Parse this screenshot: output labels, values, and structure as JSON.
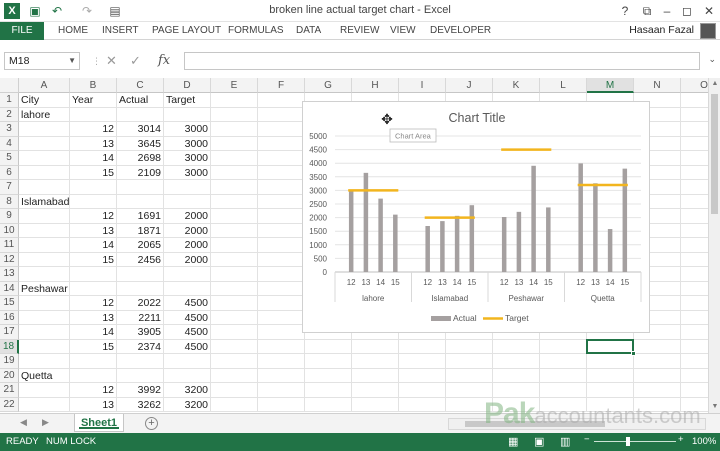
{
  "window": {
    "title": "broken line actual target chart - Excel",
    "controls": [
      "?",
      "⧉",
      "–",
      "◻",
      "✕"
    ]
  },
  "ribbon": {
    "file": "FILE",
    "tabs": [
      "HOME",
      "INSERT",
      "PAGE LAYOUT",
      "FORMULAS",
      "DATA",
      "REVIEW",
      "VIEW",
      "DEVELOPER"
    ],
    "user": "Hasaan Fazal"
  },
  "formula_bar": {
    "name_box": "M18",
    "fx": "fx",
    "value": ""
  },
  "columns": [
    "A",
    "B",
    "C",
    "D",
    "E",
    "F",
    "G",
    "H",
    "I",
    "J",
    "K",
    "L",
    "M",
    "N",
    "O"
  ],
  "selected_column": "M",
  "rows": [
    "1",
    "2",
    "3",
    "4",
    "5",
    "6",
    "7",
    "8",
    "9",
    "10",
    "11",
    "12",
    "13",
    "14",
    "15",
    "16",
    "17",
    "18",
    "19",
    "20",
    "21",
    "22"
  ],
  "selected_row": "18",
  "cells": [
    {
      "r": 1,
      "c": "A",
      "v": "City"
    },
    {
      "r": 1,
      "c": "B",
      "v": "Year"
    },
    {
      "r": 1,
      "c": "C",
      "v": "Actual"
    },
    {
      "r": 1,
      "c": "D",
      "v": "Target"
    },
    {
      "r": 2,
      "c": "A",
      "v": "lahore"
    },
    {
      "r": 3,
      "c": "B",
      "v": "12",
      "n": true
    },
    {
      "r": 3,
      "c": "C",
      "v": "3014",
      "n": true
    },
    {
      "r": 3,
      "c": "D",
      "v": "3000",
      "n": true
    },
    {
      "r": 4,
      "c": "B",
      "v": "13",
      "n": true
    },
    {
      "r": 4,
      "c": "C",
      "v": "3645",
      "n": true
    },
    {
      "r": 4,
      "c": "D",
      "v": "3000",
      "n": true
    },
    {
      "r": 5,
      "c": "B",
      "v": "14",
      "n": true
    },
    {
      "r": 5,
      "c": "C",
      "v": "2698",
      "n": true
    },
    {
      "r": 5,
      "c": "D",
      "v": "3000",
      "n": true
    },
    {
      "r": 6,
      "c": "B",
      "v": "15",
      "n": true
    },
    {
      "r": 6,
      "c": "C",
      "v": "2109",
      "n": true
    },
    {
      "r": 6,
      "c": "D",
      "v": "3000",
      "n": true
    },
    {
      "r": 8,
      "c": "A",
      "v": "Islamabad"
    },
    {
      "r": 9,
      "c": "B",
      "v": "12",
      "n": true
    },
    {
      "r": 9,
      "c": "C",
      "v": "1691",
      "n": true
    },
    {
      "r": 9,
      "c": "D",
      "v": "2000",
      "n": true
    },
    {
      "r": 10,
      "c": "B",
      "v": "13",
      "n": true
    },
    {
      "r": 10,
      "c": "C",
      "v": "1871",
      "n": true
    },
    {
      "r": 10,
      "c": "D",
      "v": "2000",
      "n": true
    },
    {
      "r": 11,
      "c": "B",
      "v": "14",
      "n": true
    },
    {
      "r": 11,
      "c": "C",
      "v": "2065",
      "n": true
    },
    {
      "r": 11,
      "c": "D",
      "v": "2000",
      "n": true
    },
    {
      "r": 12,
      "c": "B",
      "v": "15",
      "n": true
    },
    {
      "r": 12,
      "c": "C",
      "v": "2456",
      "n": true
    },
    {
      "r": 12,
      "c": "D",
      "v": "2000",
      "n": true
    },
    {
      "r": 14,
      "c": "A",
      "v": "Peshawar"
    },
    {
      "r": 15,
      "c": "B",
      "v": "12",
      "n": true
    },
    {
      "r": 15,
      "c": "C",
      "v": "2022",
      "n": true
    },
    {
      "r": 15,
      "c": "D",
      "v": "4500",
      "n": true
    },
    {
      "r": 16,
      "c": "B",
      "v": "13",
      "n": true
    },
    {
      "r": 16,
      "c": "C",
      "v": "2211",
      "n": true
    },
    {
      "r": 16,
      "c": "D",
      "v": "4500",
      "n": true
    },
    {
      "r": 17,
      "c": "B",
      "v": "14",
      "n": true
    },
    {
      "r": 17,
      "c": "C",
      "v": "3905",
      "n": true
    },
    {
      "r": 17,
      "c": "D",
      "v": "4500",
      "n": true
    },
    {
      "r": 18,
      "c": "B",
      "v": "15",
      "n": true
    },
    {
      "r": 18,
      "c": "C",
      "v": "2374",
      "n": true
    },
    {
      "r": 18,
      "c": "D",
      "v": "4500",
      "n": true
    },
    {
      "r": 20,
      "c": "A",
      "v": "Quetta"
    },
    {
      "r": 21,
      "c": "B",
      "v": "12",
      "n": true
    },
    {
      "r": 21,
      "c": "C",
      "v": "3992",
      "n": true
    },
    {
      "r": 21,
      "c": "D",
      "v": "3200",
      "n": true
    },
    {
      "r": 22,
      "c": "B",
      "v": "13",
      "n": true
    },
    {
      "r": 22,
      "c": "C",
      "v": "3262",
      "n": true
    },
    {
      "r": 22,
      "c": "D",
      "v": "3200",
      "n": true
    }
  ],
  "chart_data": {
    "type": "bar",
    "title": "Chart Title",
    "tooltip": "Chart Area",
    "groups": [
      "lahore",
      "Islamabad",
      "Peshawar",
      "Quetta"
    ],
    "categories": [
      "12",
      "13",
      "14",
      "15"
    ],
    "yticks": [
      "0",
      "500",
      "1000",
      "1500",
      "2000",
      "2500",
      "3000",
      "3500",
      "4000",
      "4500",
      "5000"
    ],
    "ylim": [
      0,
      5000
    ],
    "series": [
      {
        "name": "Actual",
        "type": "bar",
        "color": "#a5a0a0",
        "values": [
          [
            3014,
            3645,
            2698,
            2109
          ],
          [
            1691,
            1871,
            2065,
            2456
          ],
          [
            2022,
            2211,
            3905,
            2374
          ],
          [
            3992,
            3262,
            1580,
            3800
          ]
        ]
      },
      {
        "name": "Target",
        "type": "line",
        "color": "#f2b51e",
        "values": [
          3000,
          2000,
          4500,
          3200
        ]
      }
    ],
    "legend": "bottom",
    "grid": true
  },
  "sheets": [
    "Sheet1"
  ],
  "status": {
    "ready": "READY",
    "numlock": "NUM LOCK",
    "zoom": "100%"
  },
  "watermark": {
    "bold": "Pak",
    "rest": "accountants.com"
  }
}
